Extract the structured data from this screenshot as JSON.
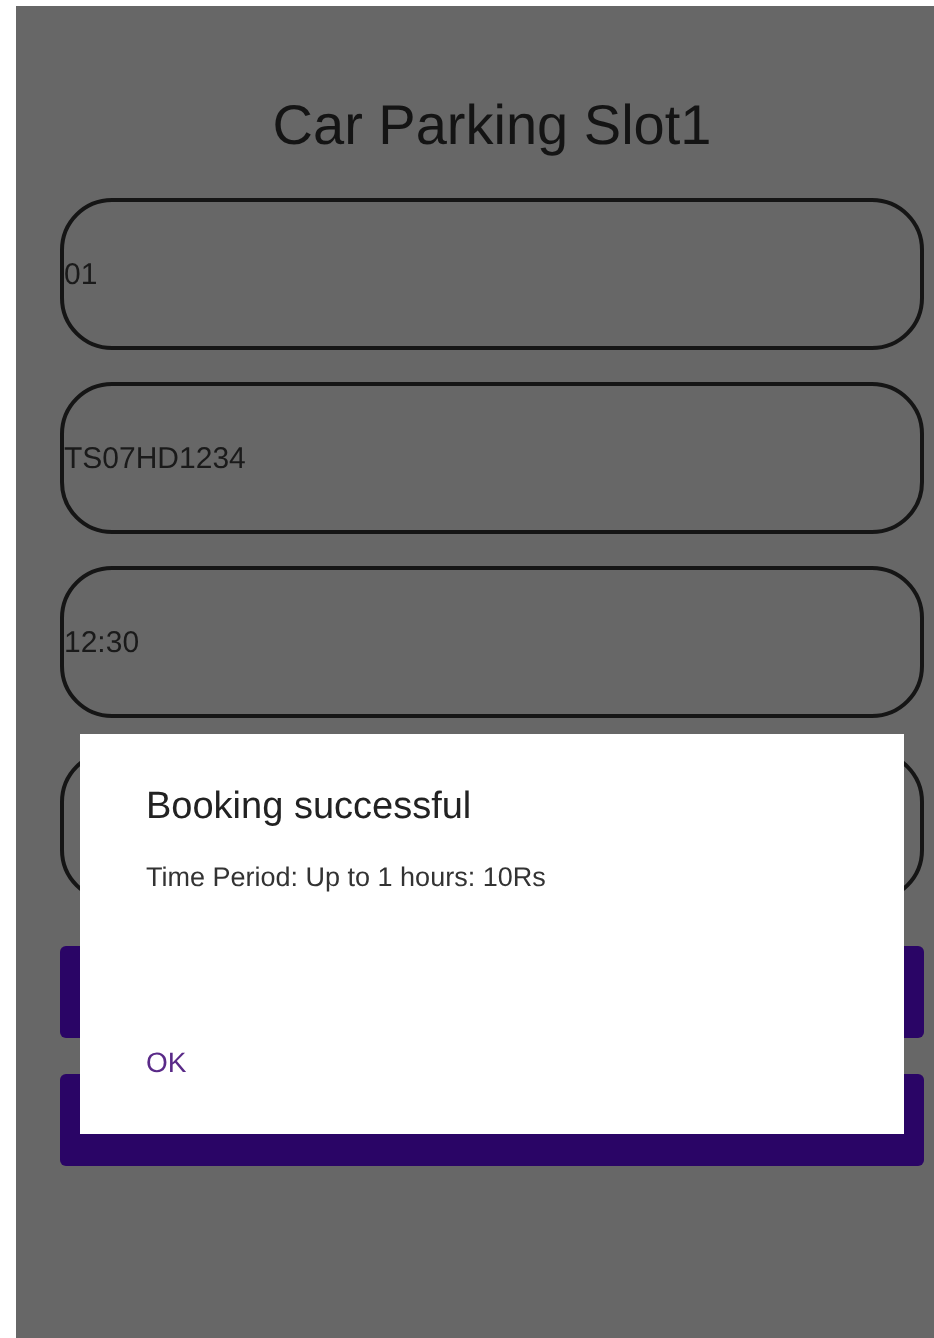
{
  "title": "Car Parking Slot1",
  "fields": [
    {
      "kind": "text",
      "value": "01"
    },
    {
      "kind": "text",
      "value": "TS07HD1234"
    },
    {
      "kind": "text",
      "value": "12:30"
    },
    {
      "kind": "text"
    }
  ],
  "buttons": [
    {
      "kind": "primary"
    },
    {
      "kind": "primary"
    }
  ],
  "dialog": {
    "title": "Booking successful",
    "message": "Time Period: Up to 1 hours: 10Rs",
    "actions": [
      "OK"
    ]
  }
}
